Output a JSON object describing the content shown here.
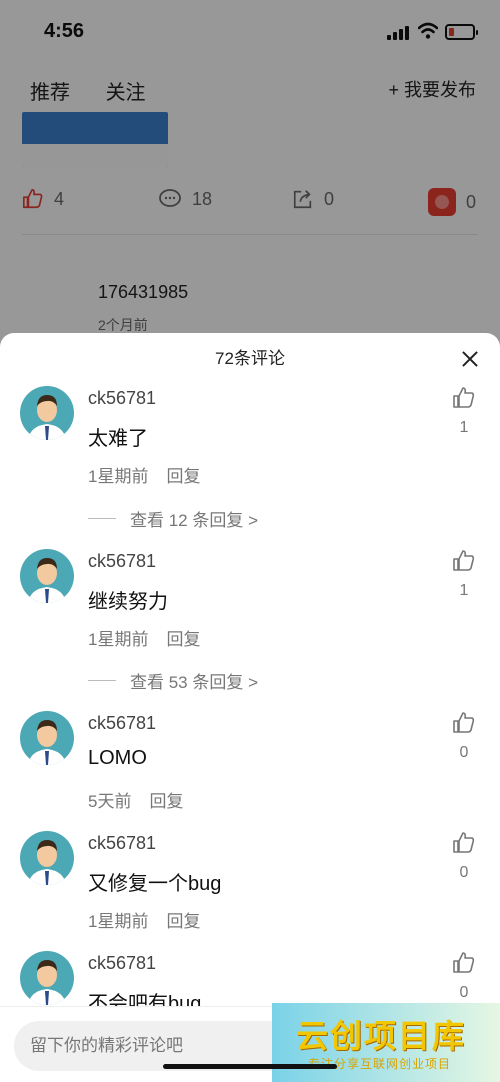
{
  "status": {
    "time": "4:56"
  },
  "background": {
    "tabs": [
      "推荐",
      "关注"
    ],
    "publish_label": "+ 我要发布",
    "stats": {
      "likes": "4",
      "comments": "18",
      "shares": "0",
      "collects": "0"
    },
    "post_user": "176431985",
    "post_time": "2个月前"
  },
  "sheet": {
    "title": "72条评论",
    "comments": [
      {
        "user": "ck56781",
        "text": "太难了",
        "time": "1星期前",
        "reply": "回复",
        "likes": "1",
        "more": "查看 12 条回复 >"
      },
      {
        "user": "ck56781",
        "text": "继续努力",
        "time": "1星期前",
        "reply": "回复",
        "likes": "1",
        "more": "查看 53 条回复 >"
      },
      {
        "user": "ck56781",
        "text": "LOMO",
        "time": "5天前",
        "reply": "回复",
        "likes": "0"
      },
      {
        "user": "ck56781",
        "text": "又修复一个bug",
        "time": "1星期前",
        "reply": "回复",
        "likes": "0"
      },
      {
        "user": "ck56781",
        "text": "不会吧有bug",
        "likes": "0"
      }
    ]
  },
  "input": {
    "placeholder": "留下你的精彩评论吧"
  },
  "watermark": {
    "title": "云创项目库",
    "subtitle": "专注分享互联网创业项目"
  },
  "colors": {
    "like_icon_red": "#e03a2f",
    "avatar_bg": "#4ca8b4"
  }
}
